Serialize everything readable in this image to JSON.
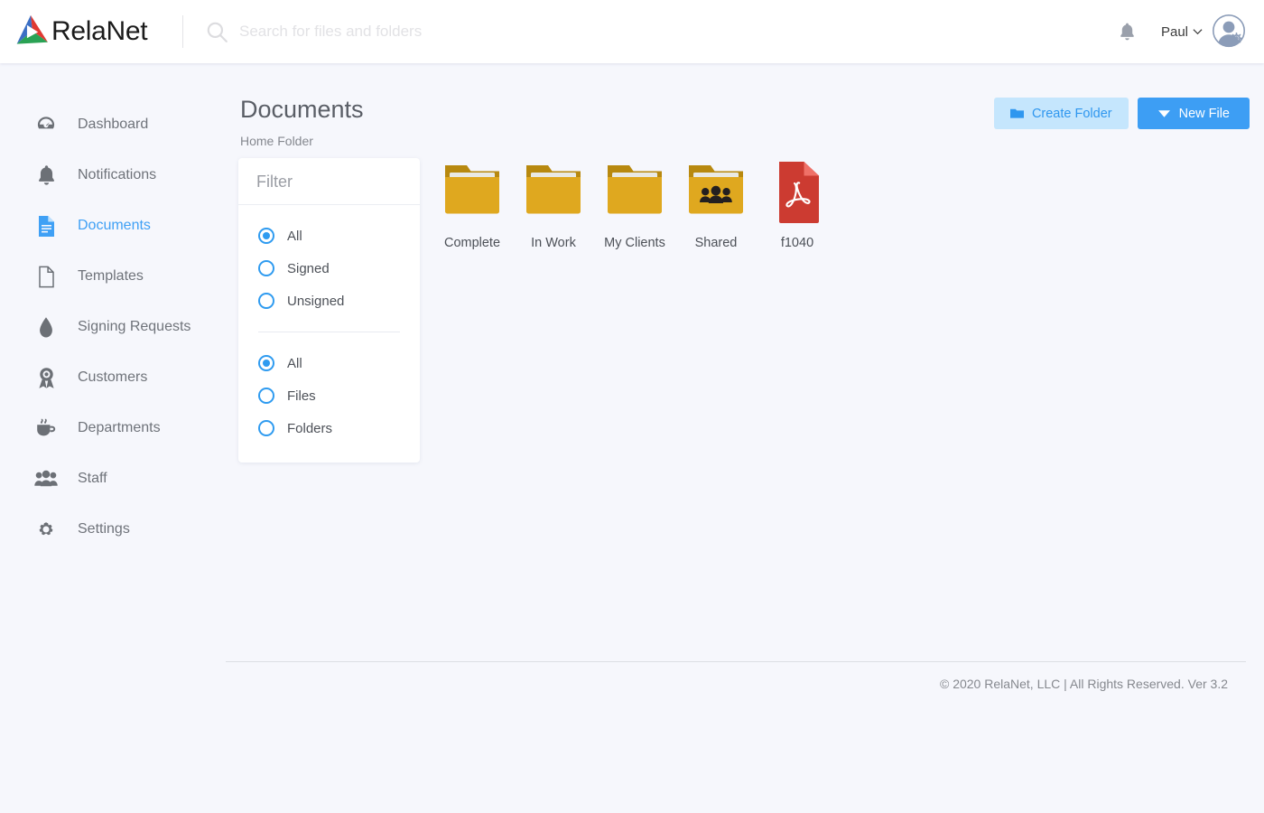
{
  "brand": {
    "name": "RelaNet",
    "logo_icon": "relanet-triangle-logo",
    "colors": {
      "red": "#e03a33",
      "blue": "#3b6fc4",
      "green": "#2aa254"
    }
  },
  "search": {
    "placeholder": "Search for files and folders",
    "value": "",
    "icon": "search-icon"
  },
  "topbar": {
    "notifications_icon": "bell-icon",
    "user_name": "Paul",
    "user_caret_icon": "chevron-down-icon",
    "avatar_icon": "user-avatar-with-gear-icon"
  },
  "sidebar": {
    "items": [
      {
        "label": "Dashboard",
        "icon": "dashboard-icon",
        "active": false
      },
      {
        "label": "Notifications",
        "icon": "bell-icon",
        "active": false
      },
      {
        "label": "Documents",
        "icon": "document-lines-icon",
        "active": true
      },
      {
        "label": "Templates",
        "icon": "page-blank-icon",
        "active": false
      },
      {
        "label": "Signing Requests",
        "icon": "ink-drop-icon",
        "active": false
      },
      {
        "label": "Customers",
        "icon": "award-ribbon-icon",
        "active": false
      },
      {
        "label": "Departments",
        "icon": "coffee-cup-icon",
        "active": false
      },
      {
        "label": "Staff",
        "icon": "people-group-icon",
        "active": false
      },
      {
        "label": "Settings",
        "icon": "gear-icon",
        "active": false
      }
    ]
  },
  "main": {
    "title": "Documents",
    "breadcrumb": "Home Folder",
    "actions": {
      "create_folder": {
        "label": "Create Folder",
        "icon": "folder-icon"
      },
      "new_file": {
        "label": "New File",
        "icon": "caret-down-icon"
      }
    },
    "filter": {
      "title": "Filter",
      "groups": [
        {
          "name": "sign-status",
          "options": [
            {
              "label": "All",
              "checked": true
            },
            {
              "label": "Signed",
              "checked": false
            },
            {
              "label": "Unsigned",
              "checked": false
            }
          ]
        },
        {
          "name": "item-type",
          "options": [
            {
              "label": "All",
              "checked": true
            },
            {
              "label": "Files",
              "checked": false
            },
            {
              "label": "Folders",
              "checked": false
            }
          ]
        }
      ]
    },
    "files": [
      {
        "name": "Complete",
        "type": "folder",
        "icon": "folder-icon"
      },
      {
        "name": "In Work",
        "type": "folder",
        "icon": "folder-icon"
      },
      {
        "name": "My Clients",
        "type": "folder",
        "icon": "folder-icon"
      },
      {
        "name": "Shared",
        "type": "shared-folder",
        "icon": "folder-shared-people-icon"
      },
      {
        "name": "f1040",
        "type": "pdf",
        "icon": "pdf-file-icon"
      }
    ]
  },
  "footer": {
    "text": "© 2020 RelaNet, LLC | All Rights Reserved. Ver 3.2"
  },
  "theme": {
    "accent": "#3d9ef4",
    "accent_light": "#c5e6fd",
    "folder": "#dfa81f",
    "pdf_red": "#cc3b31",
    "page_bg": "#f6f7fc"
  }
}
